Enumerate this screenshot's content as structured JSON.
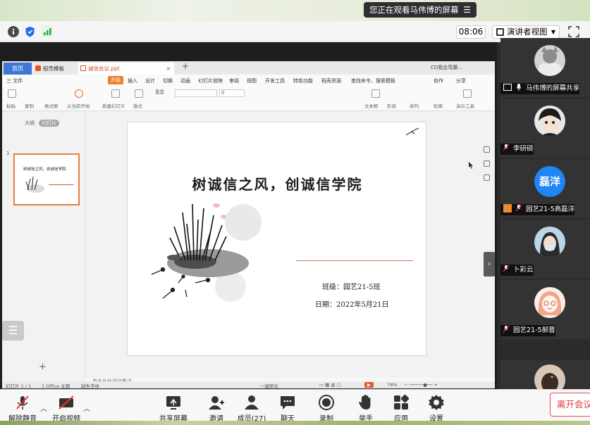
{
  "banner": {
    "text": "您正在观看马伟博的屏幕",
    "menu_icon": "menu-icon"
  },
  "toolbar": {
    "time": "08:06",
    "view_label": "演讲者视图",
    "icons": [
      "info-icon",
      "shield-icon",
      "signal-icon",
      "fullscreen-icon"
    ]
  },
  "wps": {
    "tabs": {
      "home": "首页",
      "templates": "稻壳模板",
      "document": "诚信会议.ppt",
      "user": "CD我会弯腰..."
    },
    "menu": [
      "三 文件",
      "开始",
      "插入",
      "设计",
      "切换",
      "动画",
      "幻灯片放映",
      "审阅",
      "视图",
      "开发工具",
      "特色功能",
      "稻壳资源",
      "查找命令、搜索模板",
      "协作",
      "分享"
    ],
    "ribbon": [
      "粘贴",
      "复制",
      "格式刷",
      "从当前开始",
      "新建幻灯片",
      "版式",
      "重置",
      "文本框",
      "形状",
      "排列",
      "轮廓",
      "演示工具"
    ],
    "panel_tabs": {
      "outline": "大纲",
      "slides": "幻灯片"
    },
    "slide_number": "1",
    "notes_placeholder": "单击此处添加备注",
    "status": {
      "slide": "幻灯片 1 / 1",
      "theme": "1 Office 主题",
      "font": "缺失字体",
      "beautify": "一键美化",
      "zoom": "78%"
    }
  },
  "slide": {
    "title": "树诚信之风，创诚信学院",
    "class_line": "班级：园艺21-5班",
    "date_line": "日期：2022年5月21日",
    "thumb_title": "树诚信之风，创诚信学院"
  },
  "participants": [
    {
      "name": "马伟博的屏幕共享",
      "avatar": "avatar-photo-cat"
    },
    {
      "name": "李研硕",
      "avatar": "avatar-cartoon"
    },
    {
      "name": "园艺21-5高磊洋",
      "avatar_text": "磊洋"
    },
    {
      "name": "卜彩云",
      "avatar": "avatar-photo-girl"
    },
    {
      "name": "园艺21-5郝晋",
      "avatar": "avatar-cartoon-girl"
    }
  ],
  "bottom": {
    "unmute": "解除静音",
    "start_video": "开启视频",
    "share_screen": "共享屏幕",
    "invite": "邀请",
    "members": "成员(27)",
    "chat": "聊天",
    "record": "录制",
    "raise_hand": "举手",
    "apps": "应用",
    "settings": "设置",
    "leave": "离开会议"
  },
  "colors": {
    "accent_orange": "#ef7e25",
    "wps_blue": "#3d77d6",
    "leave_red": "#e13b3b",
    "avatar_blue": "#1e86f5"
  }
}
